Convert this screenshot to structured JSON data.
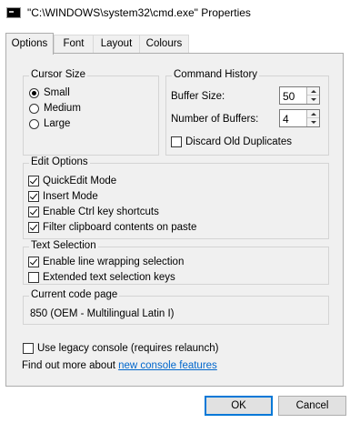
{
  "window": {
    "title": "\"C:\\WINDOWS\\system32\\cmd.exe\" Properties",
    "icon": "console-icon"
  },
  "tabs": [
    {
      "label": "Options",
      "active": true
    },
    {
      "label": "Font",
      "active": false
    },
    {
      "label": "Layout",
      "active": false
    },
    {
      "label": "Colours",
      "active": false
    }
  ],
  "cursor_size": {
    "legend": "Cursor Size",
    "options": [
      {
        "label": "Small",
        "selected": true
      },
      {
        "label": "Medium",
        "selected": false
      },
      {
        "label": "Large",
        "selected": false
      }
    ]
  },
  "command_history": {
    "legend": "Command History",
    "buffer_size_label": "Buffer Size:",
    "buffer_size_value": "50",
    "num_buffers_label": "Number of Buffers:",
    "num_buffers_value": "4",
    "discard_label": "Discard Old Duplicates",
    "discard_checked": false
  },
  "edit_options": {
    "legend": "Edit Options",
    "items": [
      {
        "label": "QuickEdit Mode",
        "checked": true
      },
      {
        "label": "Insert Mode",
        "checked": true
      },
      {
        "label": "Enable Ctrl key shortcuts",
        "checked": true
      },
      {
        "label": "Filter clipboard contents on paste",
        "checked": true
      }
    ]
  },
  "text_selection": {
    "legend": "Text Selection",
    "items": [
      {
        "label": "Enable line wrapping selection",
        "checked": true
      },
      {
        "label": "Extended text selection keys",
        "checked": false
      }
    ]
  },
  "code_page": {
    "legend": "Current code page",
    "value": "850   (OEM - Multilingual Latin I)"
  },
  "legacy": {
    "label": "Use legacy console (requires relaunch)",
    "checked": false
  },
  "find_more": {
    "prefix": "Find out more about ",
    "link": "new console features"
  },
  "buttons": {
    "ok": "OK",
    "cancel": "Cancel"
  }
}
